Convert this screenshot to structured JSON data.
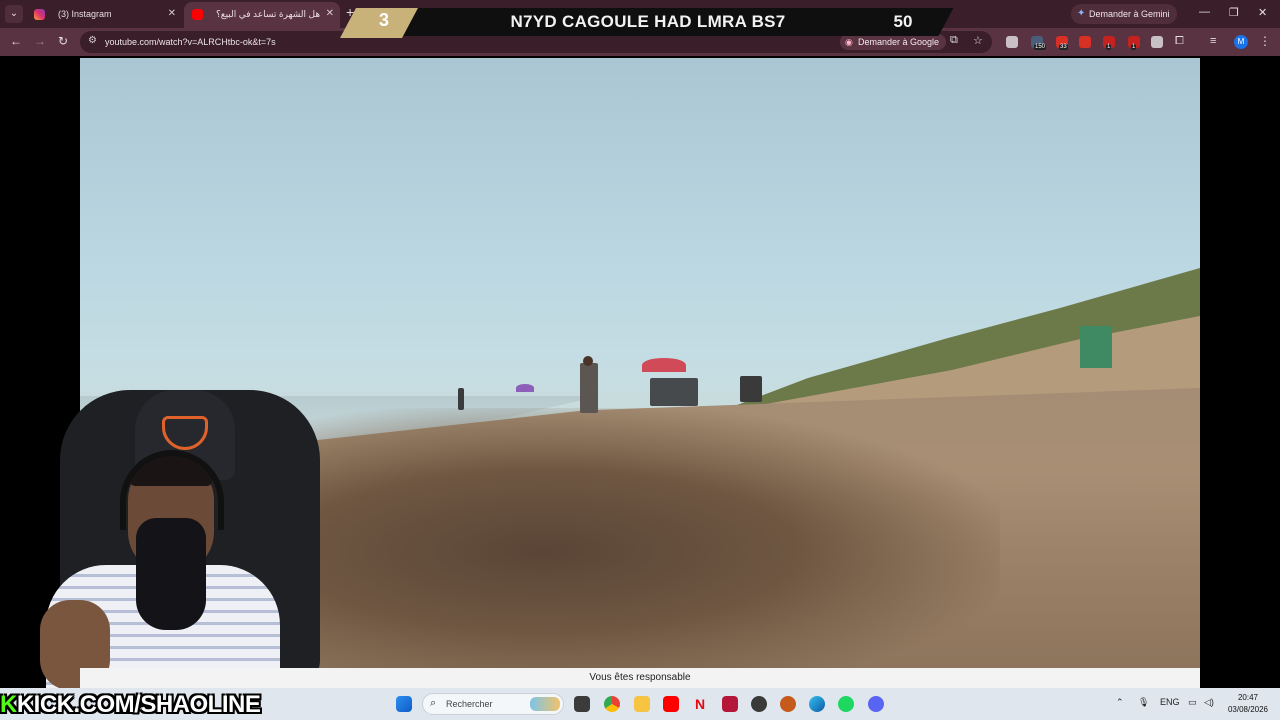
{
  "browser": {
    "tabs": [
      {
        "label": "(3) Instagram",
        "icon": "instagram-icon"
      },
      {
        "label": "هل الشهرة تساعد في البيع؟",
        "icon": "youtube-icon"
      }
    ],
    "gemini_label": "Demander à Gemini",
    "url": "youtube.com/watch?v=ALRCHtbc-ok&t=7s",
    "ask_google_label": "Demander à Google",
    "profile_initial": "M",
    "extension_counts": [
      "150",
      "33",
      "1",
      "1"
    ]
  },
  "overlay": {
    "number": "3",
    "title": "N7YD CAGOULE HAD LMRA BS7",
    "count": "50",
    "number_color": "#c9b27a"
  },
  "caption": {
    "text": "Vous êtes responsable"
  },
  "watermark": {
    "prefix": "K",
    "text": "KICK.COM/SHAOLINE",
    "accent": "#53fc18"
  },
  "taskbar": {
    "search_placeholder": "Rechercher",
    "language": "ENG",
    "time": "20:47",
    "date": "03/08/2026"
  }
}
